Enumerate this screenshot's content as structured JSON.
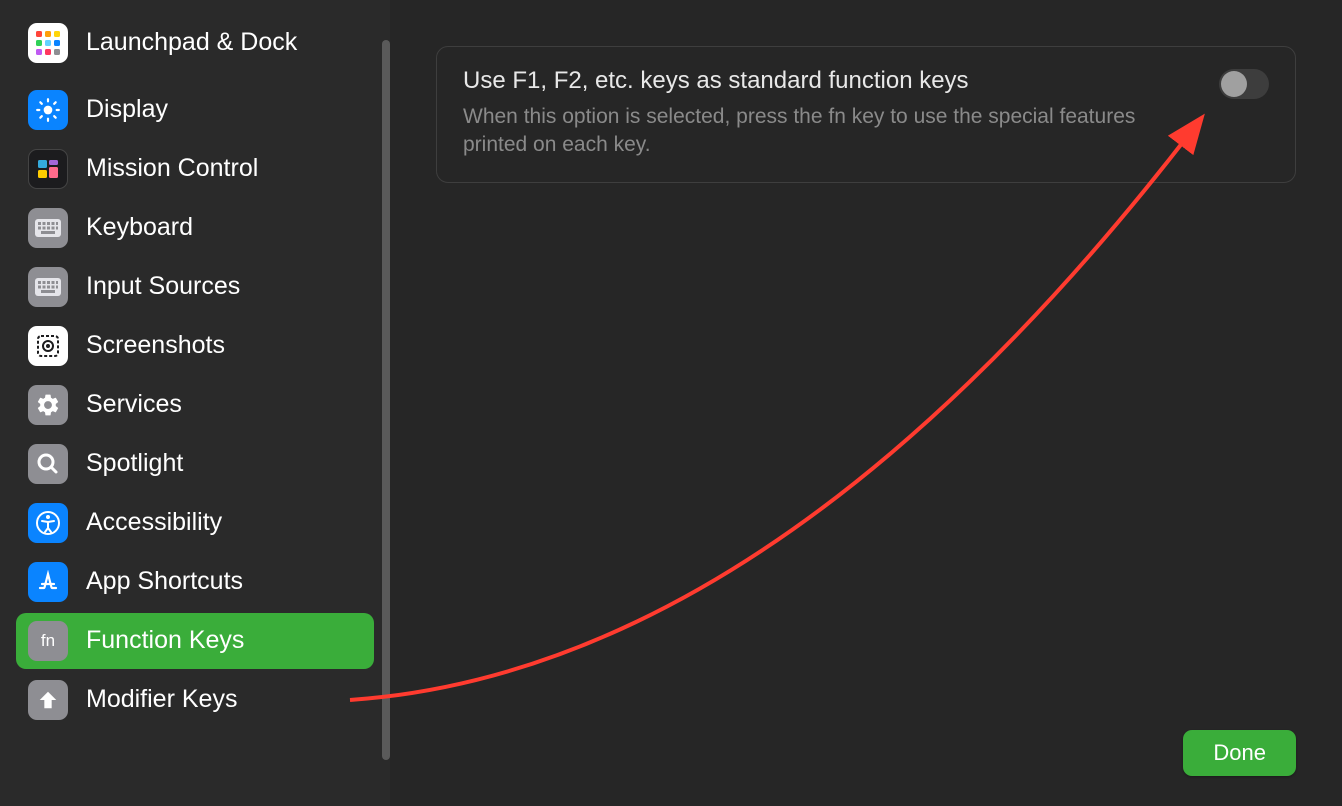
{
  "sidebar": {
    "items": [
      {
        "label": "Launchpad & Dock",
        "icon": "launchpad-icon",
        "bg": "linear-gradient(135deg,#ff5e3a,#ffcc00,#4cd964,#34aadc,#cc73e1)",
        "multi": true
      },
      {
        "label": "Display",
        "icon": "brightness-icon",
        "bg": "#0a84ff"
      },
      {
        "label": "Mission Control",
        "icon": "mission-control-icon",
        "bg": "#1c1c1e"
      },
      {
        "label": "Keyboard",
        "icon": "keyboard-icon",
        "bg": "#8e8e93"
      },
      {
        "label": "Input Sources",
        "icon": "keyboard-icon",
        "bg": "#8e8e93"
      },
      {
        "label": "Screenshots",
        "icon": "screenshot-icon",
        "bg": "#ffffff"
      },
      {
        "label": "Services",
        "icon": "gears-icon",
        "bg": "#8e8e93"
      },
      {
        "label": "Spotlight",
        "icon": "search-icon",
        "bg": "#8e8e93"
      },
      {
        "label": "Accessibility",
        "icon": "accessibility-icon",
        "bg": "#0a84ff"
      },
      {
        "label": "App Shortcuts",
        "icon": "appstore-icon",
        "bg": "#0a84ff"
      },
      {
        "label": "Function Keys",
        "icon": "fn-icon",
        "bg": "#8e8e93",
        "selected": true
      },
      {
        "label": "Modifier Keys",
        "icon": "modifier-icon",
        "bg": "#8e8e93"
      }
    ]
  },
  "setting": {
    "title": "Use F1, F2, etc. keys as standard function keys",
    "description": "When this option is selected, press the fn key to use the special features printed on each key.",
    "toggled": false
  },
  "footer": {
    "done_label": "Done"
  },
  "colors": {
    "accent_green": "#3aad3a",
    "annotation_red": "#ff3b2f"
  }
}
